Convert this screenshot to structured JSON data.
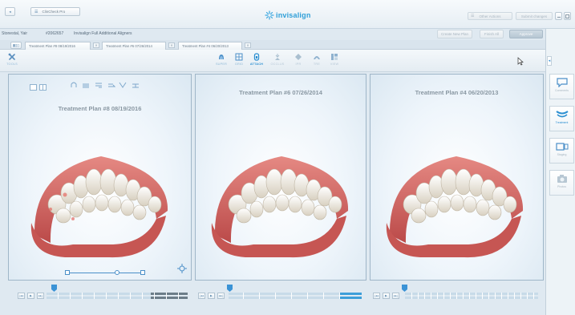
{
  "topbar": {
    "back_label": "◂",
    "app_menu_label": "ClinCheck Pro",
    "logo_text": "invisalign",
    "other_actions_label": "Other Actions",
    "submit_changes_label": "Submit changes"
  },
  "patient": {
    "name": "Stonestal, Yair",
    "id": "#2062657",
    "treatment": "Invisalign Full Additional Aligners",
    "create_plan_label": "Create New Plan",
    "approve_label": "Approve",
    "finish_label": "Finish All"
  },
  "tabs": [
    {
      "label": "Treatment Plan #8 08/19/2016"
    },
    {
      "label": "Treatment Plan #6 07/26/2014"
    },
    {
      "label": "Treatment Plan #4 06/20/2013"
    }
  ],
  "toolbar": {
    "tools_label": "TOOLS",
    "items": [
      {
        "label": "SUPER",
        "icon": "super-icon"
      },
      {
        "label": "GRID",
        "icon": "grid-icon"
      },
      {
        "label": "ATTACH",
        "icon": "attach-icon"
      },
      {
        "label": "OCCLUS",
        "icon": "occlus-icon"
      },
      {
        "label": "IPR",
        "icon": "ipr-icon"
      },
      {
        "label": "TRE",
        "icon": "tre-icon"
      },
      {
        "label": "VIEW",
        "icon": "view-icon"
      }
    ]
  },
  "panels": [
    {
      "title": "Treatment Plan #8 08/19/2016"
    },
    {
      "title": "Treatment Plan #6 07/26/2014"
    },
    {
      "title": "Treatment Plan #4 06/20/2013"
    }
  ],
  "timeline_labels": {
    "first": "|◂◂",
    "play": "▶",
    "last": "▸▸|"
  },
  "sidebar": {
    "items": [
      {
        "label": "Comments"
      },
      {
        "label": "Treatment"
      },
      {
        "label": "Staging"
      },
      {
        "label": "Photos"
      }
    ]
  }
}
